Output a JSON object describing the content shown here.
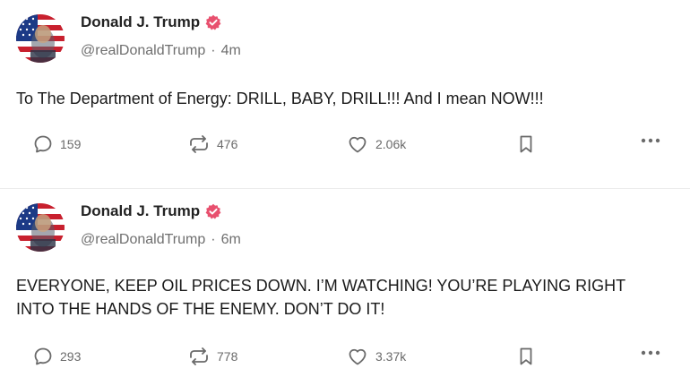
{
  "posts": [
    {
      "author": {
        "name": "Donald J. Trump",
        "handle": "@realDonaldTrump",
        "time": "4m",
        "avatar_icon": "flag-portrait-avatar",
        "verified_icon": "verified-badge-icon"
      },
      "text": "To The Department of Energy: DRILL, BABY, DRILL!!!  And I mean NOW!!!",
      "stats": {
        "replies": "159",
        "retruths": "476",
        "likes": "2.06k"
      }
    },
    {
      "author": {
        "name": "Donald J. Trump",
        "handle": "@realDonaldTrump",
        "time": "6m",
        "avatar_icon": "flag-portrait-avatar",
        "verified_icon": "verified-badge-icon"
      },
      "text": "EVERYONE, KEEP OIL PRICES DOWN. I’M WATCHING! YOU’RE PLAYING RIGHT INTO THE HANDS OF THE ENEMY. DON’T DO IT!",
      "stats": {
        "replies": "293",
        "retruths": "778",
        "likes": "3.37k"
      }
    }
  ],
  "meta_separator": "·",
  "icons": [
    "reply-icon",
    "retruth-icon",
    "like-heart-icon",
    "bookmark-icon",
    "more-options-icon"
  ],
  "colors": {
    "verified_badge": "#e8506e",
    "action_gray": "#6a6a6a",
    "name": "#222222",
    "handle": "#6f6f6f"
  }
}
